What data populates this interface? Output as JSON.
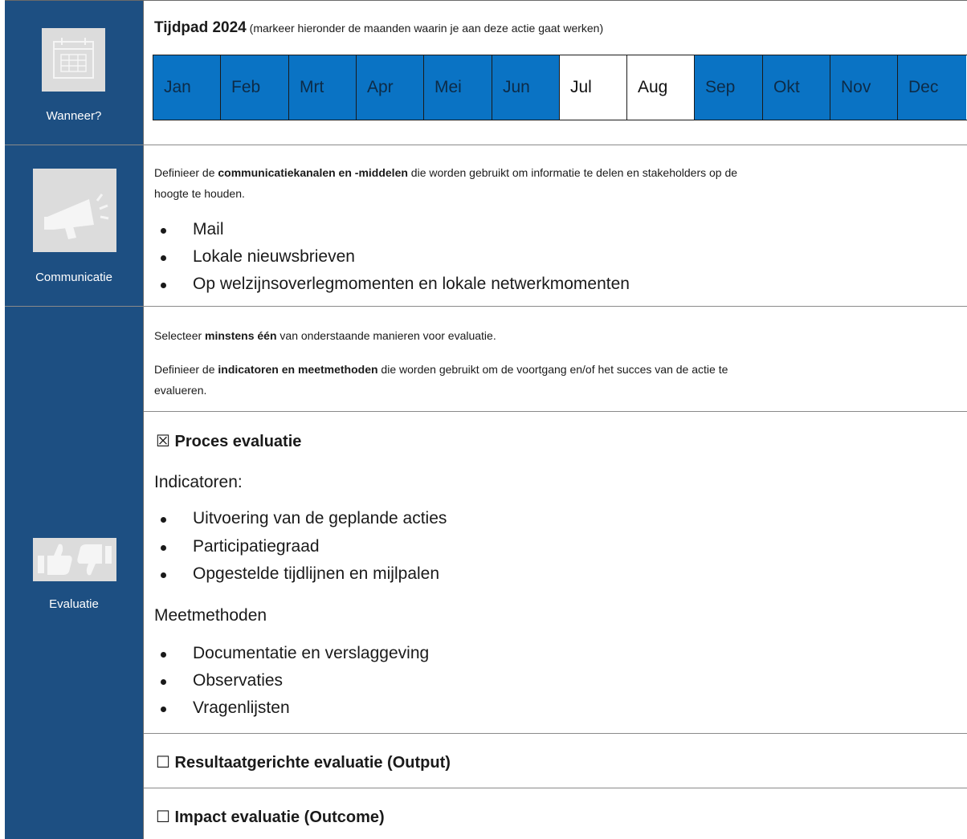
{
  "sections": {
    "when": {
      "side_label": "Wanneer?",
      "icon": "calendar-icon",
      "title": "Tijdpad 2024",
      "subtitle": "(markeer hieronder de maanden waarin je aan deze actie gaat werken)",
      "months": [
        {
          "label": "Jan",
          "selected": true
        },
        {
          "label": "Feb",
          "selected": true
        },
        {
          "label": "Mrt",
          "selected": true
        },
        {
          "label": "Apr",
          "selected": true
        },
        {
          "label": "Mei",
          "selected": true
        },
        {
          "label": "Jun",
          "selected": true
        },
        {
          "label": "Jul",
          "selected": false
        },
        {
          "label": "Aug",
          "selected": false
        },
        {
          "label": "Sep",
          "selected": true
        },
        {
          "label": "Okt",
          "selected": true
        },
        {
          "label": "Nov",
          "selected": true
        },
        {
          "label": "Dec",
          "selected": true
        }
      ]
    },
    "communication": {
      "side_label": "Communicatie",
      "icon": "megaphone-icon",
      "intro_before": "Definieer de ",
      "intro_bold": "communicatiekanalen en -middelen",
      "intro_after": " die worden gebruikt om informatie te delen en stakeholders op de",
      "intro_line2": "hoogte te houden.",
      "items": [
        "Mail",
        "Lokale nieuwsbrieven",
        "Op welzijnsoverlegmomenten en lokale netwerkmomenten"
      ]
    },
    "evaluation": {
      "side_label": "Evaluatie",
      "icon": "thumbs-up-down-icon",
      "select_before": "Selecteer ",
      "select_bold": "minstens één",
      "select_after": " van onderstaande manieren voor evaluatie.",
      "define_before": "Definieer de ",
      "define_bold": "indicatoren en meetmethoden",
      "define_after": " die worden gebruikt om de voortgang en/of het succes van de actie te",
      "define_line2": "evalueren.",
      "process": {
        "checkbox": "☒",
        "checked": true,
        "title": "Proces evaluatie",
        "indicators_label": "Indicatoren:",
        "indicators": [
          "Uitvoering van de geplande acties",
          "Participatiegraad",
          "Opgestelde tijdlijnen en mijlpalen"
        ],
        "methods_label": "Meetmethoden",
        "methods": [
          "Documentatie en verslaggeving",
          "Observaties",
          "Vragenlijsten"
        ]
      },
      "output": {
        "checkbox": "☐",
        "checked": false,
        "title": "Resultaatgerichte evaluatie (Output)"
      },
      "outcome": {
        "checkbox": "☐",
        "checked": false,
        "title": "Impact evaluatie (Outcome)"
      }
    }
  }
}
